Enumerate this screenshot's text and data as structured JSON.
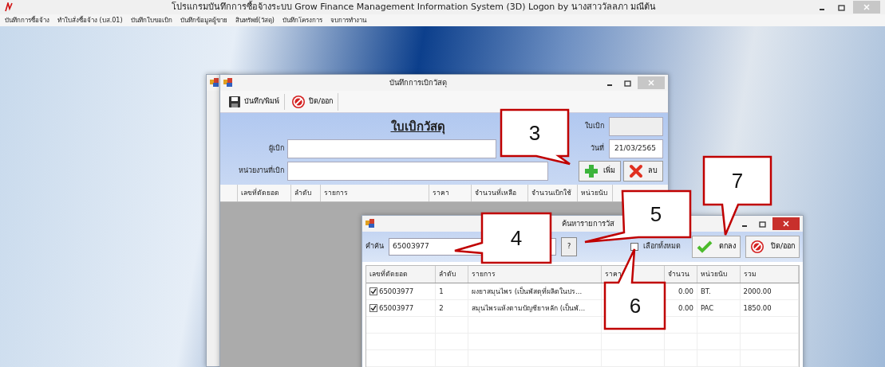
{
  "main_window": {
    "title": "โปรแกรมบันทึกการซื้อจ้างระบบ  Grow Finance Management Information System (3D) Logon by นางสาววัลลภา  มณีต้น",
    "menu": [
      "บันทึกการซื้อจ้าง",
      "ทำใบสั่งซื้อจ้าง (บส.01)",
      "บันทึกใบขอเบิก",
      "บันทึกข้อมูลผู้ขาย",
      "สินทรัพย์(วัสดุ)",
      "บันทึกโครงการ",
      "จบการทำงาน"
    ]
  },
  "requisition_window": {
    "title": "บันทึกการเบิกวัสดุ",
    "toolbar": [
      {
        "kind": "save",
        "label": "บันทึก/พิมพ์"
      },
      {
        "kind": "close",
        "label": "ปิด/ออก"
      }
    ],
    "heading": "ใบเบิกวัสดุ",
    "requisition_no": {
      "label": "ใบเบิก"
    },
    "date": {
      "label": "วันที่",
      "value": "21/03/2565"
    },
    "requester": {
      "label": "ผู้เบิก"
    },
    "department": {
      "label": "หน่วยงานที่เบิก"
    },
    "buttons": [
      {
        "kind": "add",
        "label": "เพิ่ม"
      },
      {
        "kind": "delete",
        "label": "ลบ"
      }
    ],
    "table": {
      "columns": [
        "เลขที่ตัดยอด",
        "ลำดับ",
        "รายการ",
        "ราคา",
        "จำนวนที่เหลือ",
        "จำนวนเบิกใช้",
        "หน่วยนับ"
      ]
    }
  },
  "search_window": {
    "title": "ค้นหารายการวัส",
    "search": {
      "label": "คำค้น",
      "value": "65003977"
    },
    "help_button": "?",
    "select_all": {
      "label": "เลือกทั้งหมด",
      "checked": false
    },
    "buttons": [
      {
        "kind": "ok",
        "label": "ตกลง"
      },
      {
        "kind": "close",
        "label": "ปิด/ออก"
      }
    ],
    "table": {
      "columns": [
        "เลขที่ตัดยอด",
        "ลำดับ",
        "รายการ",
        "ราคา",
        "จำนวน",
        "หน่วยนับ",
        "รวม"
      ],
      "rows": [
        {
          "checked": true,
          "code": "65003977",
          "seq": "1",
          "item": "ผงยาสมุนไพร (เป็นพัสดุที่ผลิตในปร...",
          "qty": "0.00",
          "unit": "BT.",
          "total": "2000.00"
        },
        {
          "checked": true,
          "code": "65003977",
          "seq": "2",
          "item": "สมุนไพรแห้งตามบัญชียาหลัก (เป็นพั...",
          "qty": "0.00",
          "unit": "PAC",
          "total": "1850.00"
        }
      ]
    }
  },
  "callouts": [
    "3",
    "4",
    "5",
    "6",
    "7"
  ]
}
